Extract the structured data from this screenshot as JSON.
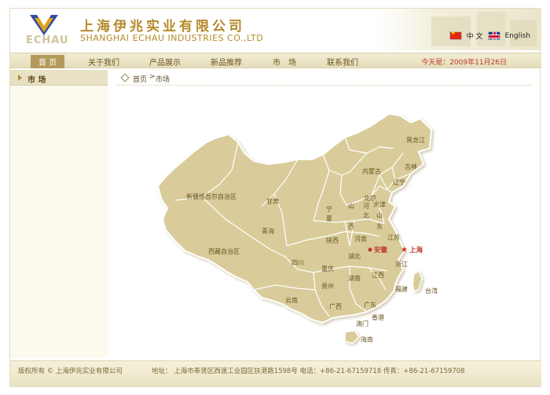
{
  "header": {
    "logo_word": "ECHAU",
    "company_cn": "上海伊兆实业有限公司",
    "company_en": "SHANGHAI ECHAU INDUSTRIES CO.,LTD",
    "lang_cn": "中 文",
    "lang_en": "English"
  },
  "nav": {
    "items": [
      "首 页",
      "关于我们",
      "产品展示",
      "新品推荐",
      "市　场",
      "联系我们"
    ],
    "active_index": 0,
    "today": "今天是：2009年11月26日"
  },
  "sidebar": {
    "title": "市 场"
  },
  "breadcrumb": {
    "home": "首页",
    "sep": ">",
    "current": "市场"
  },
  "map": {
    "provinces": {
      "heilongjiang": "黑龙江",
      "jilin": "吉林",
      "liaoning": "辽宁",
      "neimenggu": "内蒙古",
      "xinjiang": "新疆维吾尔自治区",
      "gansu": "甘肃",
      "beijing": "北京",
      "tianjin": "天津",
      "hebei_1": "河",
      "hebei_2": "北",
      "shanxi_1": "山",
      "shanxi_2": "西",
      "shandong_1": "山",
      "shandong_2": "东",
      "ningxia_1": "宁",
      "ningxia_2": "夏",
      "qinghai": "青海",
      "shaanxi": "陕西",
      "henan": "河南",
      "jiangsu": "江苏",
      "anhui": "安徽",
      "shanghai": "上海",
      "xizang": "西藏自治区",
      "sichuan": "四川",
      "hubei": "湖北",
      "zhejiang": "浙江",
      "chongqing": "重庆",
      "guizhou": "贵州",
      "hunan": "湖南",
      "jiangxi": "江西",
      "fujian": "福建",
      "taiwan": "台湾",
      "yunnan": "云南",
      "guangxi": "广西",
      "guangdong": "广东",
      "xianggang": "香港",
      "aomen": "澳门",
      "hainan": "海南"
    },
    "highlight_color": "#c0392b",
    "fill_color": "#d9cc9a",
    "border_color": "#ffffff"
  },
  "footer": {
    "copyright": "版权所有 © 上海伊兆实业有限公司",
    "address": "地址： 上海市奉贤区西渡工业园区扶港路1598号 电话：+86-21-67159718 传真：+86-21-67159708"
  }
}
